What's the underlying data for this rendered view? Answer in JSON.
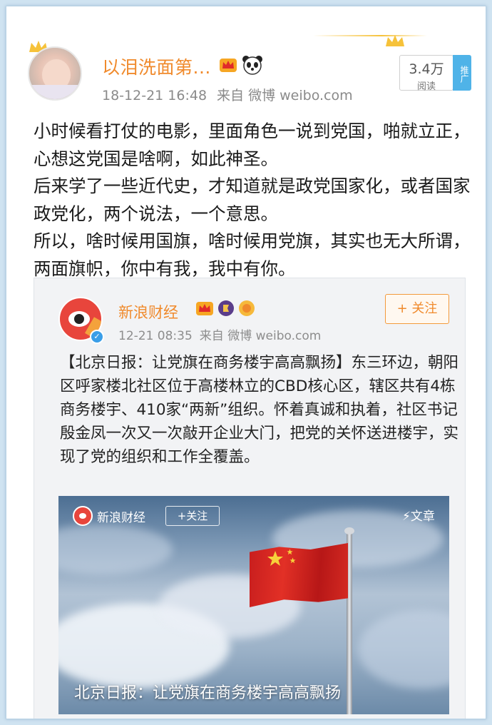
{
  "post": {
    "author": "以泪洗面第...",
    "time": "18-12-21 16:48",
    "source": "来自 微博 weibo.com",
    "reads_count": "3.4万",
    "reads_label": "阅读",
    "promote_label": "推广",
    "paragraphs": [
      "小时候看打仗的电影，里面角色一说到党国，啪就立正，心想这党国是啥啊，如此神圣。",
      "后来学了一些近代史，才知道就是政党国家化，或者国家政党化，两个说法，一个意思。",
      "所以，啥时候用国旗，啥时候用党旗，其实也无大所谓，两面旗帜，你中有我，我中有你。"
    ]
  },
  "retweet": {
    "author": "新浪财经",
    "time": "12-21 08:35",
    "source": "来自 微博 weibo.com",
    "follow_label": "+ 关注",
    "text": "【北京日报：让党旗在商务楼宇高高飘扬】东三环边，朝阳区呼家楼北社区位于高楼林立的CBD核心区，辖区共有4栋商务楼宇、410家“两新”组织。怀着真诚和执着，社区书记殷金凤一次又一次敲开企业大门，把党的关怀送进楼宇，实现了党的组织和工作全覆盖。",
    "card": {
      "source_name": "新浪财经",
      "follow_label": "+关注",
      "tag": "⚡文章",
      "title": "北京日报：让党旗在商务楼宇高高飘扬"
    }
  },
  "colors": {
    "accent_orange": "#f08a2c",
    "promote_blue": "#4fb3e8",
    "background_blue": "#cfe3f1"
  }
}
